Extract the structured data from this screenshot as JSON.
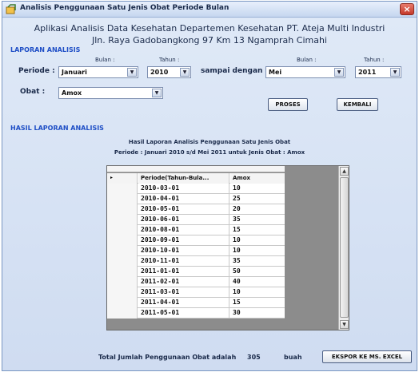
{
  "window": {
    "title": "Analisis Penggunaan Satu Jenis Obat Periode Bulan",
    "close_glyph": "×"
  },
  "header": {
    "line1": "Aplikasi Analisis Data Kesehatan Departemen Kesehatan PT. Ateja Multi Industri",
    "line2": "Jln. Raya Gadobangkong 97 Km 13 Ngamprah Cimahi"
  },
  "form": {
    "section_title": "LAPORAN ANALISIS",
    "bulan_label_1": "Bulan :",
    "tahun_label_1": "Tahun :",
    "bulan_label_2": "Bulan :",
    "tahun_label_2": "Tahun :",
    "periode_label": "Periode :",
    "sampai_label": "sampai dengan",
    "obat_label": "Obat :",
    "bulan_from": "Januari",
    "tahun_from": "2010",
    "bulan_to": "Mei",
    "tahun_to": "2011",
    "obat_value": "Amox",
    "proses_label": "PROSES",
    "kembali_label": "KEMBALI"
  },
  "result": {
    "section_title": "HASIL LAPORAN ANALISIS",
    "title": "Hasil Laporan Analisis Penggunaan Satu Jenis Obat",
    "subtitle": "Periode : Januari  2010  s/d  Mei  2011    untuk Jenis Obat  :  Amox"
  },
  "grid": {
    "columns": [
      "Periode(Tahun-Bula...",
      "Amox"
    ],
    "current_row_marker": "▸",
    "rows": [
      {
        "periode": "2010-03-01",
        "value": "10"
      },
      {
        "periode": "2010-04-01",
        "value": "25"
      },
      {
        "periode": "2010-05-01",
        "value": "20"
      },
      {
        "periode": "2010-06-01",
        "value": "35"
      },
      {
        "periode": "2010-08-01",
        "value": "15"
      },
      {
        "periode": "2010-09-01",
        "value": "10"
      },
      {
        "periode": "2010-10-01",
        "value": "10"
      },
      {
        "periode": "2010-11-01",
        "value": "35"
      },
      {
        "periode": "2011-01-01",
        "value": "50"
      },
      {
        "periode": "2011-02-01",
        "value": "40"
      },
      {
        "periode": "2011-03-01",
        "value": "10"
      },
      {
        "periode": "2011-04-01",
        "value": "15"
      },
      {
        "periode": "2011-05-01",
        "value": "30"
      }
    ]
  },
  "footer": {
    "total_label": "Total Jumlah Penggunaan Obat adalah",
    "total_value": "305",
    "total_unit": "buah",
    "export_label": "EKSPOR KE MS. EXCEL"
  },
  "icons": {
    "dropdown": "chevron-down-icon",
    "scroll_up": "scroll-up-icon",
    "scroll_down": "scroll-down-icon",
    "app": "app-icon"
  },
  "colors": {
    "section_title": "#1f4fc6",
    "grid_background": "#8c8c8c",
    "close_button": "#c4392a"
  }
}
